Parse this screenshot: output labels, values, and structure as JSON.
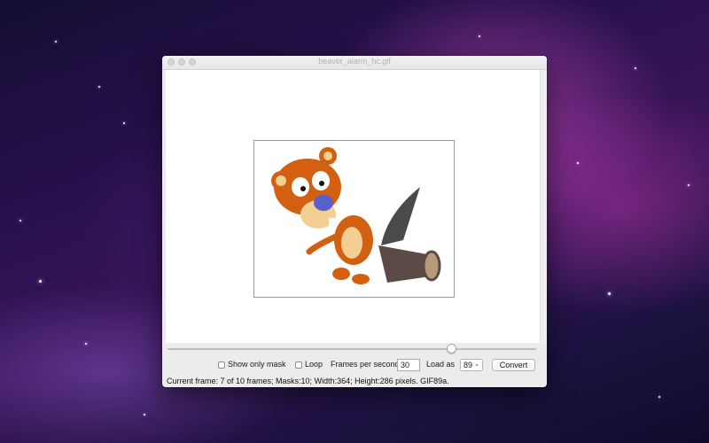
{
  "window": {
    "title": "beaver_alarm_hc.gif"
  },
  "controls": {
    "show_mask_label": "Show only mask",
    "loop_label": "Loop",
    "fps_label": "Frames per second",
    "fps_value": "30",
    "load_as_label": "Load as",
    "load_as_value": "89",
    "convert_label": "Convert"
  },
  "status": {
    "text": "Current frame: 7 of 10 frames; Masks:10; Width:364; Height:286 pixels. GIF89a."
  },
  "slider": {
    "frame": 7,
    "frame_count": 10
  },
  "icons": {
    "dropdown": "chevron-down-icon"
  }
}
